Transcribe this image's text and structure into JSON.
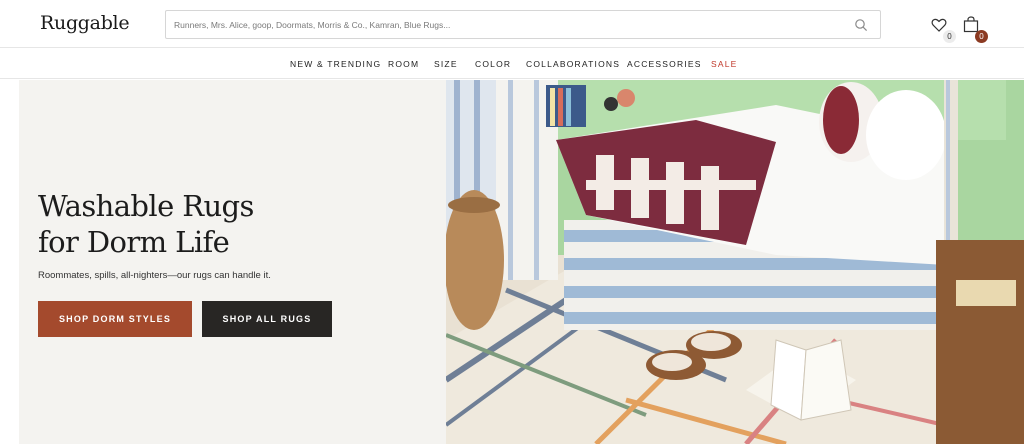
{
  "brand": {
    "logo_text": "Ruggable"
  },
  "search": {
    "placeholder": "Runners, Mrs. Alice, goop, Doormats, Morris & Co., Kamran, Blue Rugs..."
  },
  "header_icons": {
    "wishlist": {
      "icon": "heart-icon",
      "count": "0"
    },
    "cart": {
      "icon": "shopping-bag-icon",
      "count": "0"
    }
  },
  "nav": {
    "items": [
      "NEW & TRENDING",
      "ROOM",
      "SIZE",
      "COLOR",
      "COLLABORATIONS",
      "ACCESSORIES"
    ],
    "sale_label": "SALE",
    "sale_color": "#c0392b"
  },
  "hero": {
    "title_line1": "Washable Rugs",
    "title_line2": "for Dorm Life",
    "subtitle": "Roommates, spills, all-nighters—our rugs can handle it.",
    "primary_cta": "SHOP DORM STYLES",
    "secondary_cta": "SHOP ALL RUGS",
    "primary_color": "#a44a2d",
    "secondary_color": "#282624"
  }
}
